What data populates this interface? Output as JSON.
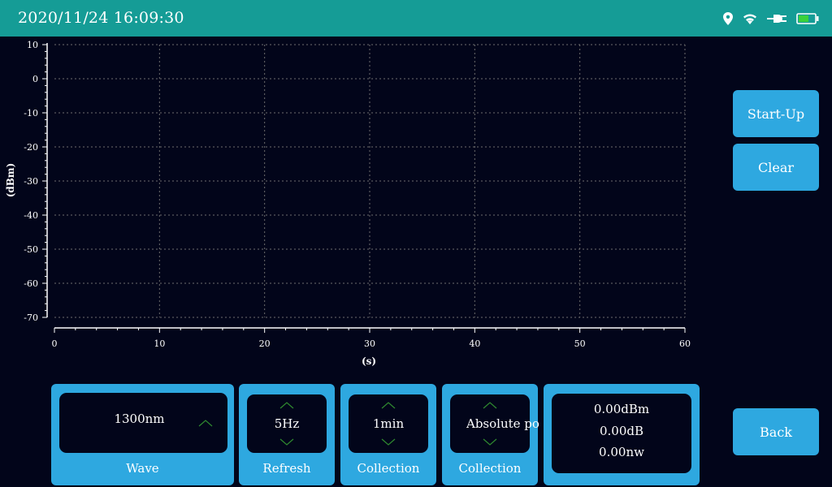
{
  "status_bar": {
    "datetime": "2020/11/24 16:09:30",
    "icons": [
      "location-icon",
      "wifi-icon",
      "plug-icon",
      "battery-icon"
    ],
    "color": "#159c96"
  },
  "chart_data": {
    "type": "line",
    "title": "",
    "xlabel": "(s)",
    "ylabel": "(dBm)",
    "xlim": [
      0,
      60
    ],
    "ylim": [
      -70,
      10
    ],
    "x_ticks": [
      0,
      10,
      20,
      30,
      40,
      50,
      60
    ],
    "y_ticks": [
      10,
      0,
      -10,
      -20,
      -30,
      -40,
      -50,
      -60,
      -70
    ],
    "grid": true,
    "series": []
  },
  "buttons": {
    "start_up": "Start-Up",
    "clear": "Clear",
    "back": "Back"
  },
  "controls": {
    "wave": {
      "value": "1300nm",
      "label": "Wave"
    },
    "refresh": {
      "value": "5Hz",
      "label": "Refresh"
    },
    "collection_time": {
      "value": "1min",
      "label": "Collection"
    },
    "collection_mode": {
      "value": "Absolute po",
      "label": "Collection"
    }
  },
  "readout": {
    "dbm": "0.00dBm",
    "db": "0.00dB",
    "nw": "0.00nw"
  },
  "colors": {
    "background": "#02051a",
    "accent": "#2ea8e0",
    "arrow": "#2f8a2f"
  }
}
